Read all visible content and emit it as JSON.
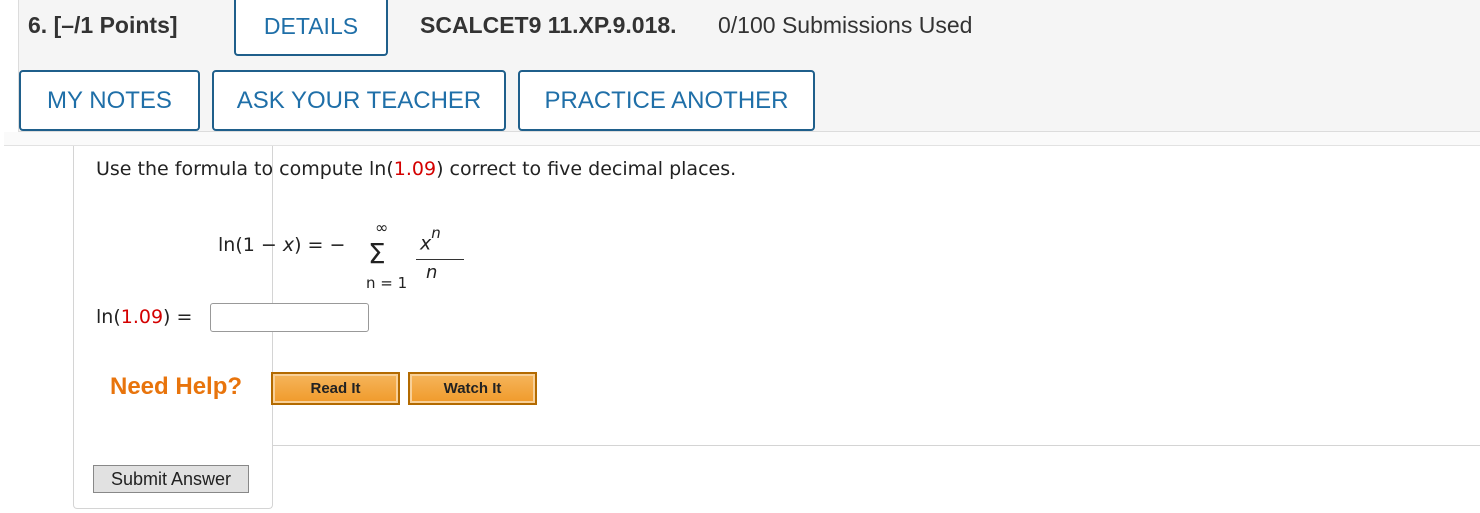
{
  "header": {
    "question_number": "6.  [–/1 Points]",
    "details_tab": "DETAILS",
    "assignment_code": "SCALCET9 11.XP.9.018.",
    "submissions": "0/100 Submissions Used",
    "buttons": {
      "my_notes": "MY NOTES",
      "ask_teacher": "ASK YOUR TEACHER",
      "practice_another": "PRACTICE ANOTHER"
    }
  },
  "question": {
    "text_before": "Use the formula to compute ln(",
    "value": "1.09",
    "text_after": ") correct to five decimal places."
  },
  "formula": {
    "lhs_prefix": "ln(1 − ",
    "lhs_var": "x",
    "lhs_suffix": ") = −",
    "sum_upper": "∞",
    "sum_symbol": "Σ",
    "sum_lower": "n = 1",
    "numerator_base": "x",
    "numerator_exp": "n",
    "denominator": "n"
  },
  "answer": {
    "label_prefix": "ln(",
    "label_value": "1.09",
    "label_suffix": ")  =",
    "input_value": ""
  },
  "help": {
    "label": "Need Help?",
    "read_it": "Read It",
    "watch_it": "Watch It"
  },
  "submit": {
    "label": "Submit Answer"
  },
  "colors": {
    "accent_blue": "#1f6fa8",
    "highlight_red": "#d40000",
    "help_orange": "#e8740c"
  }
}
